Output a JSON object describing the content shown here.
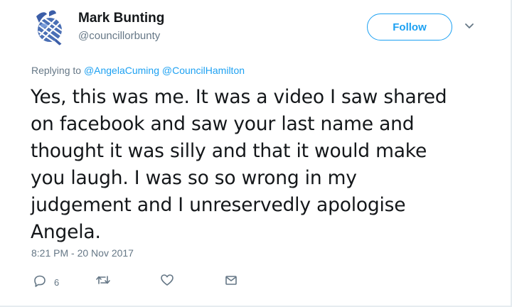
{
  "author": {
    "name": "Mark Bunting",
    "handle": "@councillorbunty"
  },
  "follow_label": "Follow",
  "replying": {
    "prefix": "Replying to",
    "mentions": [
      "@AngelaCuming",
      "@CouncilHamilton"
    ]
  },
  "tweet": {
    "lines": [
      "Yes, this was me. It was a video I saw shared",
      "on facebook and saw your last name and",
      "thought it was silly and that it would make",
      "you laugh. I was so so wrong in my",
      "judgement and I unreservedly apologise",
      "Angela."
    ]
  },
  "timestamp": "8:21 PM - 20 Nov 2017",
  "actions": {
    "reply_count": "6"
  },
  "colors": {
    "accent": "#1da1f2",
    "secondary_text": "#657786",
    "primary_text": "#14171a"
  }
}
